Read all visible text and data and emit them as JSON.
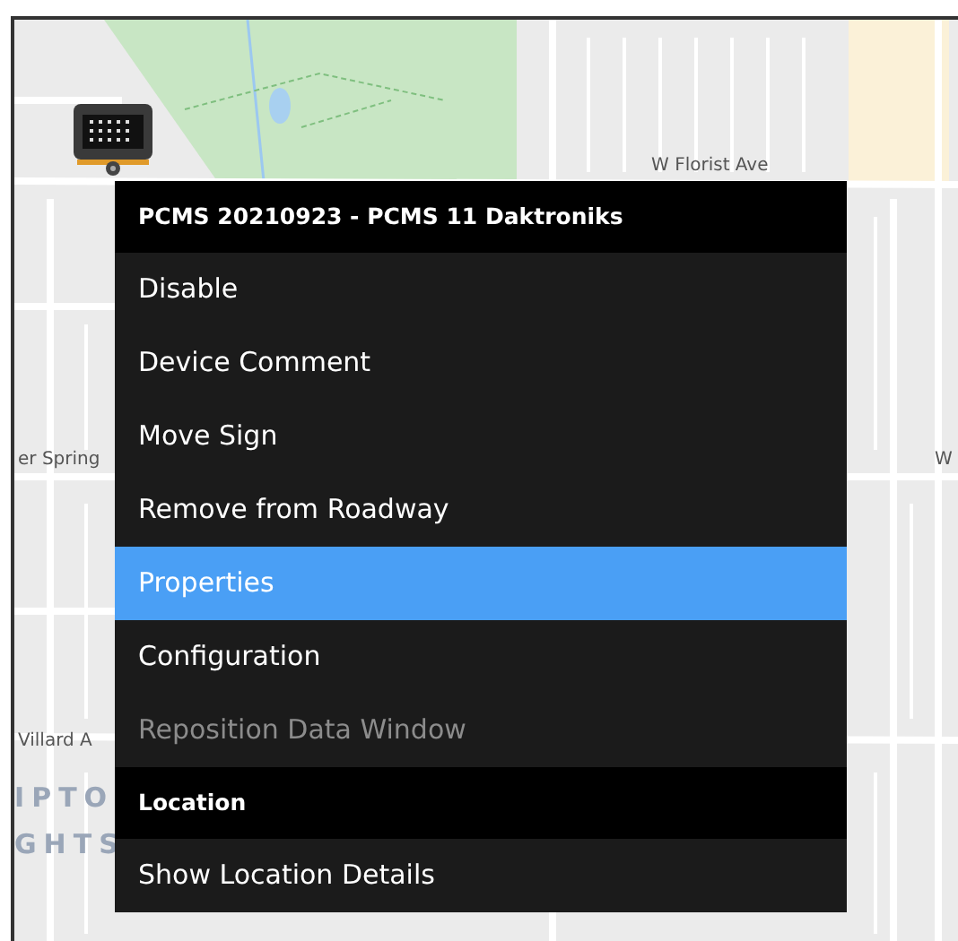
{
  "map": {
    "labels": [
      {
        "kind": "street",
        "text": "W Florist Ave"
      },
      {
        "kind": "street",
        "text": "er Spring"
      },
      {
        "kind": "street",
        "text": "W"
      },
      {
        "kind": "street",
        "text": "Villard A"
      },
      {
        "kind": "area",
        "text": "IPTO"
      },
      {
        "kind": "area",
        "text": "GHTS"
      }
    ]
  },
  "context_menu": {
    "items": [
      {
        "kind": "header",
        "label": "PCMS 20210923 - PCMS 11 Daktroniks"
      },
      {
        "kind": "item",
        "label": "Disable",
        "selected": false,
        "disabled": false
      },
      {
        "kind": "item",
        "label": "Device Comment",
        "selected": false,
        "disabled": false
      },
      {
        "kind": "item",
        "label": "Move Sign",
        "selected": false,
        "disabled": false
      },
      {
        "kind": "item",
        "label": "Remove from Roadway",
        "selected": false,
        "disabled": false
      },
      {
        "kind": "item",
        "label": "Properties",
        "selected": true,
        "disabled": false
      },
      {
        "kind": "item",
        "label": "Configuration",
        "selected": false,
        "disabled": false
      },
      {
        "kind": "item",
        "label": "Reposition Data Window",
        "selected": false,
        "disabled": true
      },
      {
        "kind": "header",
        "label": "Location"
      },
      {
        "kind": "item",
        "label": "Show Location Details",
        "selected": false,
        "disabled": false
      }
    ]
  }
}
